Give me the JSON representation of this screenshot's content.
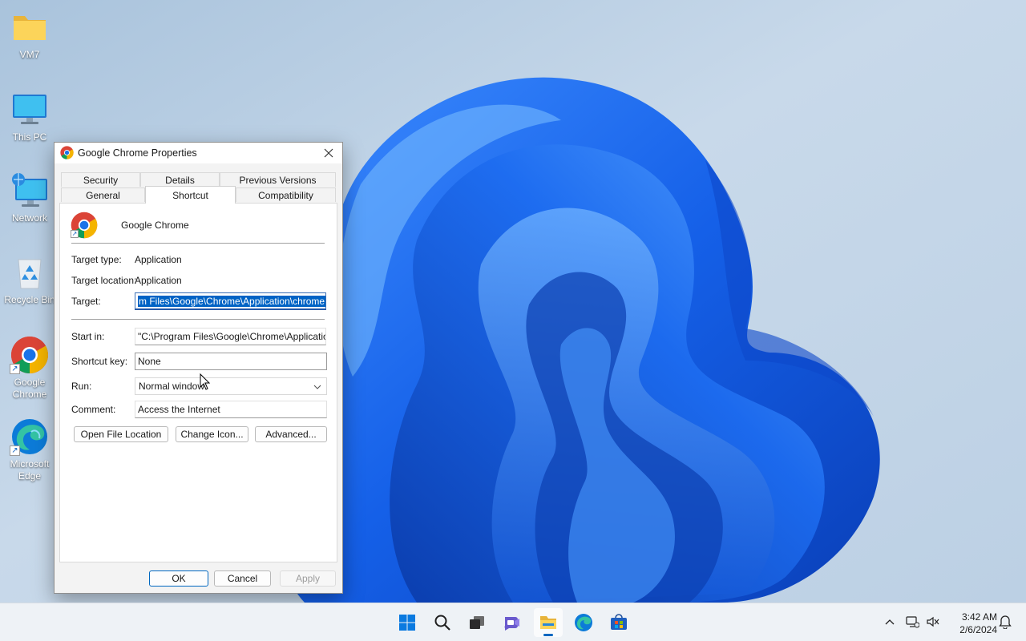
{
  "desktop": {
    "icons": [
      {
        "label": "VM7"
      },
      {
        "label": "This PC"
      },
      {
        "label": "Network"
      },
      {
        "label": "Recycle Bin"
      },
      {
        "label": "Google Chrome"
      },
      {
        "label": "Microsoft Edge"
      }
    ]
  },
  "dialog": {
    "title": "Google Chrome Properties",
    "tabs_row1": [
      {
        "label": "Security"
      },
      {
        "label": "Details"
      },
      {
        "label": "Previous Versions"
      }
    ],
    "tabs_row2": [
      {
        "label": "General"
      },
      {
        "label": "Shortcut",
        "active": true
      },
      {
        "label": "Compatibility"
      }
    ],
    "app_name": "Google Chrome",
    "target_type_label": "Target type:",
    "target_type_value": "Application",
    "target_location_label": "Target location:",
    "target_location_value": "Application",
    "target_label": "Target:",
    "target_value": "m Files\\Google\\Chrome\\Application\\chrome.exe\"",
    "start_in_label": "Start in:",
    "start_in_value": "\"C:\\Program Files\\Google\\Chrome\\Application\"",
    "shortcut_key_label": "Shortcut key:",
    "shortcut_key_value": "None",
    "run_label": "Run:",
    "run_value": "Normal window",
    "comment_label": "Comment:",
    "comment_value": "Access the Internet",
    "open_file_location": "Open File Location",
    "change_icon": "Change Icon...",
    "advanced": "Advanced...",
    "ok": "OK",
    "cancel": "Cancel",
    "apply": "Apply"
  },
  "taskbar": {
    "apps": [
      {
        "icon": "windows-start-icon"
      },
      {
        "icon": "search-icon"
      },
      {
        "icon": "task-view-icon"
      },
      {
        "icon": "chat-icon"
      },
      {
        "icon": "file-explorer-icon",
        "active": true
      },
      {
        "icon": "edge-icon"
      },
      {
        "icon": "store-icon"
      }
    ],
    "time": "3:42 AM",
    "date": "2/6/2024"
  },
  "colors": {
    "accent": "#0067c0",
    "selection": "#0063c5",
    "wallpaper_blue": "#1565e8"
  }
}
